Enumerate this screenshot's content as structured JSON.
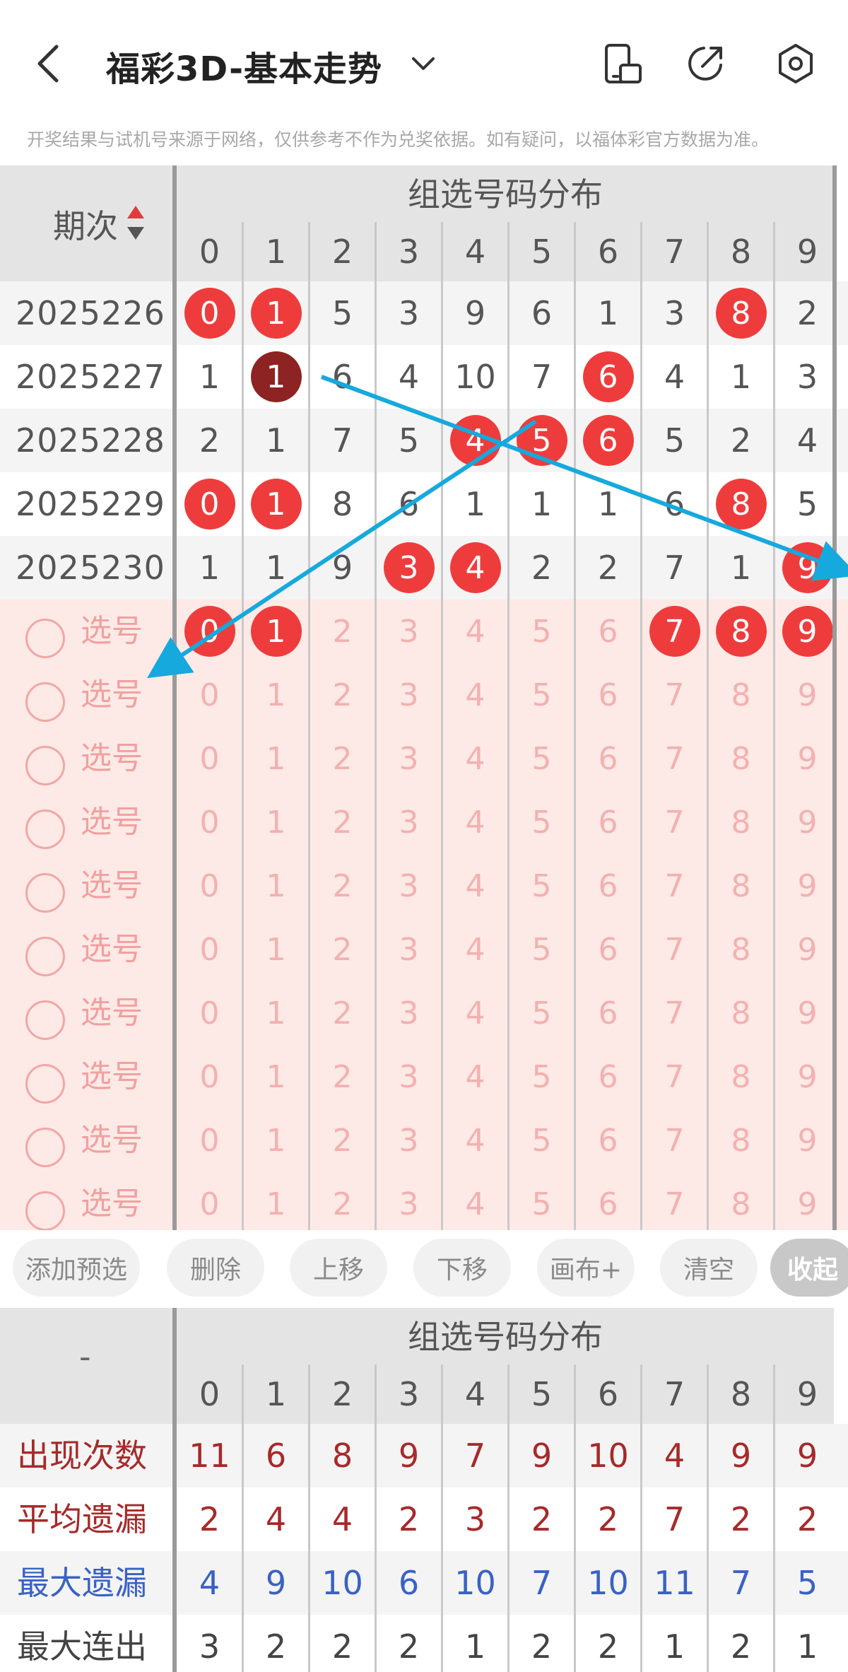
{
  "header": {
    "title": "福彩3D-基本走势",
    "disclaimer": "开奖结果与试机号来源于网络，仅供参考不作为兑奖依据。如有疑问，以福体彩官方数据为准。"
  },
  "table": {
    "period_header": "期次",
    "group_title": "组选号码分布",
    "digits": [
      "0",
      "1",
      "2",
      "3",
      "4",
      "5",
      "6",
      "7",
      "8",
      "9"
    ],
    "rows": [
      {
        "period": "2025226",
        "values": [
          "0",
          "1",
          "5",
          "3",
          "9",
          "6",
          "1",
          "3",
          "8",
          "2"
        ],
        "hits": [
          true,
          true,
          false,
          false,
          false,
          false,
          false,
          false,
          true,
          false
        ],
        "dark": [
          false,
          false,
          false,
          false,
          false,
          false,
          false,
          false,
          false,
          false
        ]
      },
      {
        "period": "2025227",
        "values": [
          "1",
          "1",
          "6",
          "4",
          "10",
          "7",
          "6",
          "4",
          "1",
          "3"
        ],
        "hits": [
          false,
          true,
          false,
          false,
          false,
          false,
          true,
          false,
          false,
          false
        ],
        "dark": [
          false,
          true,
          false,
          false,
          false,
          false,
          false,
          false,
          false,
          false
        ]
      },
      {
        "period": "2025228",
        "values": [
          "2",
          "1",
          "7",
          "5",
          "4",
          "5",
          "6",
          "5",
          "2",
          "4"
        ],
        "hits": [
          false,
          false,
          false,
          false,
          true,
          true,
          true,
          false,
          false,
          false
        ],
        "dark": [
          false,
          false,
          false,
          false,
          false,
          false,
          false,
          false,
          false,
          false
        ]
      },
      {
        "period": "2025229",
        "values": [
          "0",
          "1",
          "8",
          "6",
          "1",
          "1",
          "1",
          "6",
          "8",
          "5"
        ],
        "hits": [
          true,
          true,
          false,
          false,
          false,
          false,
          false,
          false,
          true,
          false
        ],
        "dark": [
          false,
          false,
          false,
          false,
          false,
          false,
          false,
          false,
          false,
          false
        ]
      },
      {
        "period": "2025230",
        "values": [
          "1",
          "1",
          "9",
          "3",
          "4",
          "2",
          "2",
          "7",
          "1",
          "9"
        ],
        "hits": [
          false,
          false,
          false,
          true,
          true,
          false,
          false,
          false,
          false,
          true
        ],
        "dark": [
          false,
          false,
          false,
          false,
          false,
          false,
          false,
          false,
          false,
          false
        ]
      }
    ],
    "select_label": "选号",
    "select_rows": [
      {
        "selected": [
          true,
          true,
          false,
          false,
          false,
          false,
          false,
          true,
          true,
          true
        ]
      },
      {
        "selected": [
          false,
          false,
          false,
          false,
          false,
          false,
          false,
          false,
          false,
          false
        ]
      },
      {
        "selected": [
          false,
          false,
          false,
          false,
          false,
          false,
          false,
          false,
          false,
          false
        ]
      },
      {
        "selected": [
          false,
          false,
          false,
          false,
          false,
          false,
          false,
          false,
          false,
          false
        ]
      },
      {
        "selected": [
          false,
          false,
          false,
          false,
          false,
          false,
          false,
          false,
          false,
          false
        ]
      },
      {
        "selected": [
          false,
          false,
          false,
          false,
          false,
          false,
          false,
          false,
          false,
          false
        ]
      },
      {
        "selected": [
          false,
          false,
          false,
          false,
          false,
          false,
          false,
          false,
          false,
          false
        ]
      },
      {
        "selected": [
          false,
          false,
          false,
          false,
          false,
          false,
          false,
          false,
          false,
          false
        ]
      },
      {
        "selected": [
          false,
          false,
          false,
          false,
          false,
          false,
          false,
          false,
          false,
          false
        ]
      },
      {
        "selected": [
          false,
          false,
          false,
          false,
          false,
          false,
          false,
          false,
          false,
          false
        ]
      }
    ]
  },
  "actions": {
    "add_preselect": "添加预选",
    "delete": "删除",
    "move_up": "上移",
    "move_down": "下移",
    "canvas_plus": "画布+",
    "clear": "清空",
    "collapse": "收起"
  },
  "stats": {
    "corner": "-",
    "group_title": "组选号码分布",
    "rows": [
      {
        "label": "出现次数",
        "values": [
          "11",
          "6",
          "8",
          "9",
          "7",
          "9",
          "10",
          "4",
          "9",
          "9"
        ],
        "color": "#a62a2a"
      },
      {
        "label": "平均遗漏",
        "values": [
          "2",
          "4",
          "4",
          "2",
          "3",
          "2",
          "2",
          "7",
          "2",
          "2"
        ],
        "color": "#a62a2a"
      },
      {
        "label": "最大遗漏",
        "values": [
          "4",
          "9",
          "10",
          "6",
          "10",
          "7",
          "10",
          "11",
          "7",
          "5"
        ],
        "color": "#3a62c4"
      },
      {
        "label": "最大连出",
        "values": [
          "3",
          "2",
          "2",
          "2",
          "1",
          "2",
          "2",
          "1",
          "2",
          "1"
        ],
        "color": "#444444"
      }
    ]
  },
  "colors": {
    "hit_ball": "#ee3c3c",
    "hit_ball_dark": "#8e2323",
    "draw_line": "#16a9dd",
    "sort_up": "#e23b3b",
    "sort_down": "#555555"
  }
}
